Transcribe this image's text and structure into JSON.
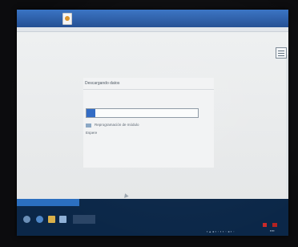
{
  "dialog": {
    "title": "Descargando datos",
    "progress_percent": 8,
    "module_label": "Reprogramación de módulo",
    "status_label": "Espere"
  },
  "taskbar": {
    "icons": [
      "start-icon",
      "edge-icon",
      "file-explorer-icon",
      "store-icon",
      "app-icon"
    ]
  },
  "colors": {
    "title_bar": "#2a5fae",
    "progress_fill": "#2f69c4",
    "taskbar": "#0b2748"
  }
}
